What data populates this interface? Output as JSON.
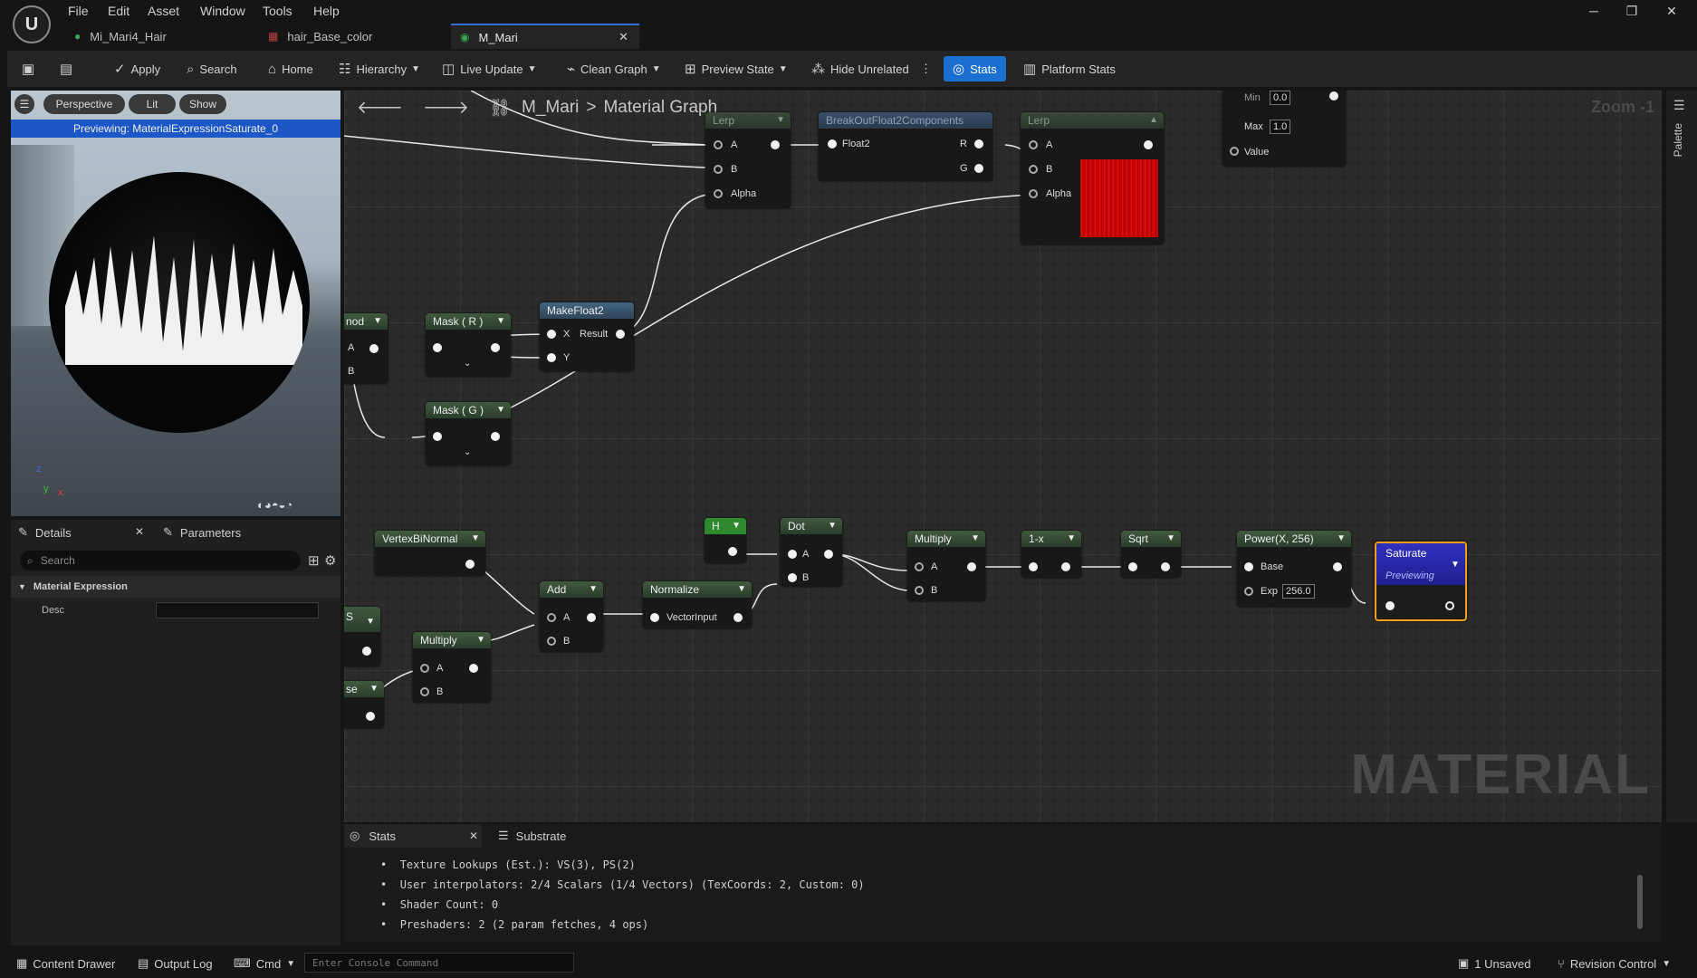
{
  "menu": [
    "File",
    "Edit",
    "Asset",
    "Window",
    "Tools",
    "Help"
  ],
  "tabs": [
    {
      "label": "Mi_Mari4_Hair",
      "icon": "●"
    },
    {
      "label": "hair_Base_color",
      "icon": "▦"
    },
    {
      "label": "M_Mari",
      "icon": "◉",
      "close": "✕"
    }
  ],
  "window": {
    "minimize": "─",
    "restore": "❐",
    "close": "✕"
  },
  "toolbar": {
    "apply": "Apply",
    "search": "Search",
    "home": "Home",
    "hierarchy": "Hierarchy",
    "live_update": "Live Update",
    "clean_graph": "Clean Graph",
    "preview_state": "Preview State",
    "hide_unrelated": "Hide Unrelated",
    "stats": "Stats",
    "platform_stats": "Platform Stats",
    "more": "⋮"
  },
  "viewport": {
    "perspective": "Perspective",
    "lit": "Lit",
    "show": "Show",
    "previewing": "Previewing: MaterialExpressionSaturate_0",
    "axis_z": "z",
    "axis_y": "y",
    "axis_x": "x"
  },
  "details": {
    "tab_details": "Details",
    "tab_parameters": "Parameters",
    "close": "✕",
    "search_placeholder": "Search",
    "section": "Material Expression",
    "desc_label": "Desc",
    "desc_value": ""
  },
  "graph": {
    "breadcrumb_root": "M_Mari",
    "breadcrumb_sep": ">",
    "breadcrumb_current": "Material Graph",
    "zoom": "Zoom -1",
    "watermark": "MATERIAL",
    "nodes": {
      "lerp1": {
        "title": "Lerp",
        "a": "A",
        "b": "B",
        "alpha": "Alpha"
      },
      "breakout": {
        "title": "BreakOutFloat2Components",
        "in": "Float2",
        "r": "R",
        "g": "G"
      },
      "lerp2": {
        "title": "Lerp",
        "a": "A",
        "b": "B",
        "alpha": "Alpha"
      },
      "clamp": {
        "min_label": "Min",
        "min": "0.0",
        "max_label": "Max",
        "max": "1.0",
        "value": "Value"
      },
      "fmod": {
        "title": "nod",
        "a": "A",
        "b": "B"
      },
      "mask_r": {
        "title": "Mask ( R )"
      },
      "makefloat2": {
        "title": "MakeFloat2",
        "x": "X",
        "y": "Y",
        "result": "Result"
      },
      "mask_g": {
        "title": "Mask ( G )"
      },
      "vertexbinormal": {
        "title": "VertexBiNormal"
      },
      "h": {
        "title": "H"
      },
      "dot": {
        "title": "Dot",
        "a": "A",
        "b": "B"
      },
      "multiply1": {
        "title": "Multiply",
        "a": "A",
        "b": "B"
      },
      "oneminus": {
        "title": "1-x"
      },
      "sqrt": {
        "title": "Sqrt"
      },
      "power": {
        "title": "Power(X, 256)",
        "base": "Base",
        "exp_label": "Exp",
        "exp": "256.0"
      },
      "saturate": {
        "title": "Saturate",
        "sub": "Previewing"
      },
      "add": {
        "title": "Add",
        "a": "A",
        "b": "B"
      },
      "normalize": {
        "title": "Normalize",
        "in": "VectorInput"
      },
      "multiply2": {
        "title": "Multiply",
        "a": "A",
        "b": "B"
      },
      "ws": {
        "title": "S"
      },
      "se": {
        "title": "se"
      }
    }
  },
  "stats": {
    "tab_stats": "Stats",
    "tab_substrate": "Substrate",
    "close": "✕",
    "lines": [
      "Texture Lookups (Est.): VS(3), PS(2)",
      "User interpolators: 2/4 Scalars (1/4 Vectors) (TexCoords: 2, Custom: 0)",
      "Shader Count: 0",
      "Preshaders: 2  (2 param fetches, 4 ops)"
    ]
  },
  "statusbar": {
    "content_drawer": "Content Drawer",
    "output_log": "Output Log",
    "cmd": "Cmd",
    "console_placeholder": "Enter Console Command",
    "unsaved": "1 Unsaved",
    "revision_control": "Revision Control"
  },
  "palette": "Palette"
}
